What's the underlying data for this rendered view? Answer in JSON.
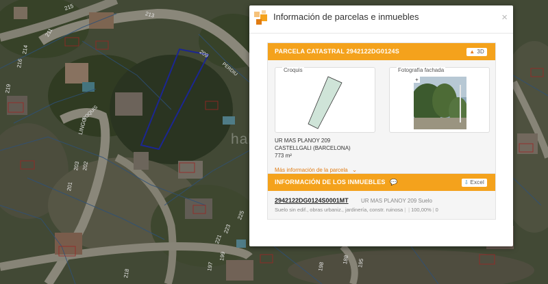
{
  "dialog": {
    "title": "Información de parcelas e inmuebles",
    "close": "×"
  },
  "parcel": {
    "header": "PARCELA CATASTRAL 2942122DG0124S",
    "btn_3d": "3D",
    "croquis_label": "Croquis",
    "foto_label": "Fotografía fachada",
    "photo_plus": "+",
    "address_line1": "UR MAS PLANOY 209",
    "address_line2": "CASTELLGALI (BARCELONA)",
    "area": "773 m²",
    "more_info": "Más información de la parcela"
  },
  "inmuebles": {
    "header": "INFORMACIÓN DE LOS INMUEBLES",
    "excel": "Excel",
    "ref": "2942122DG0124S0001MT",
    "ref_address": "UR MAS PLANOY 209 Suelo",
    "desc": "Suelo sin edif., obras urbaniz., jardinería, constr. ruinosa",
    "pct": "100,00%",
    "count": "0"
  },
  "map_labels": {
    "street1": "PERDIU",
    "street2": "LINGO",
    "street3": "ROQUIS",
    "watermark": "habitaclia",
    "n215": "215",
    "n213": "213",
    "n209": "209",
    "n211": "211",
    "n214": "214",
    "n216": "216",
    "n219": "219",
    "n203": "203",
    "n202": "202",
    "n201": "201",
    "n199": "199",
    "n197": "197",
    "n225": "225",
    "n223": "223",
    "n221": "221",
    "n218": "218",
    "n188": "188",
    "n195": "195",
    "n198": "198"
  }
}
